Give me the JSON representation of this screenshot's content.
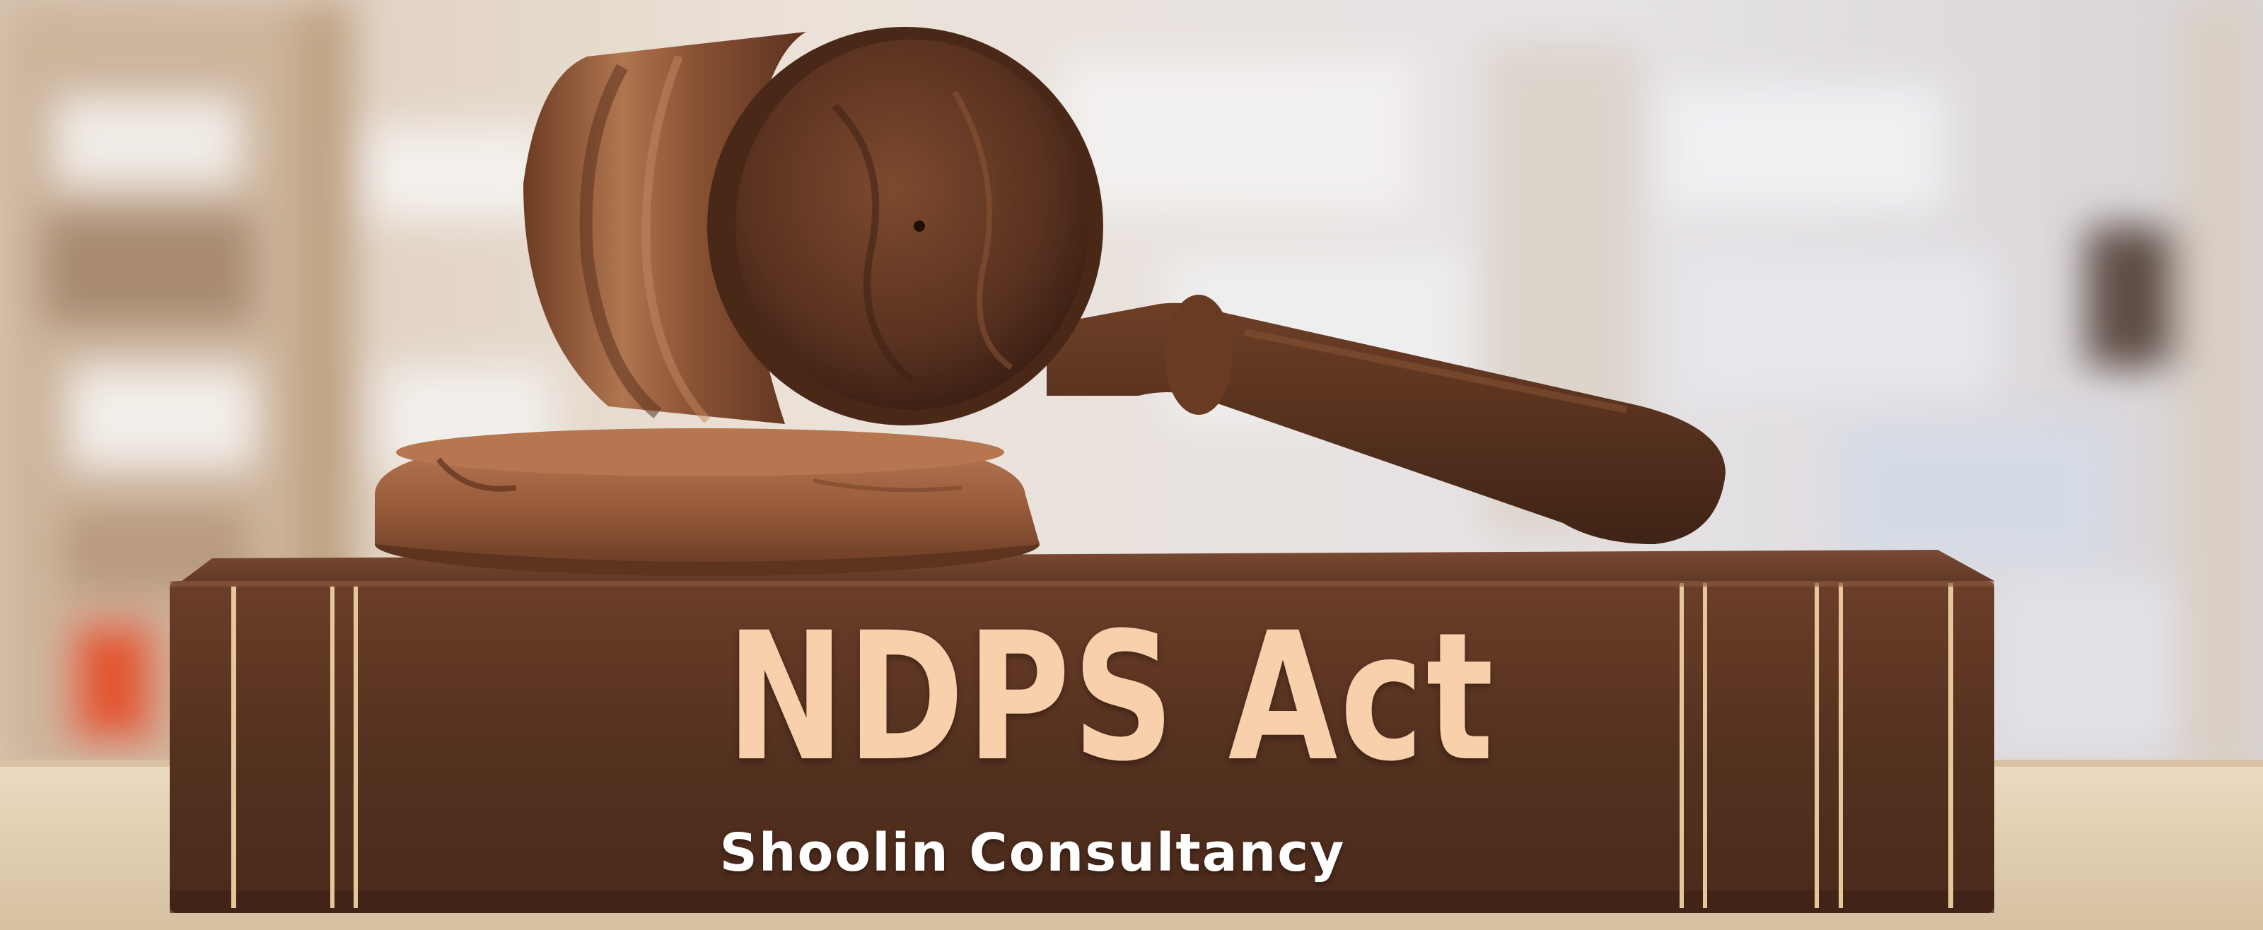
{
  "banner": {
    "title": "NDPS Act",
    "subtitle": "Shoolin Consultancy"
  },
  "scene": {
    "objects": [
      "gavel-icon",
      "sound-block",
      "law-book",
      "bookshelf-background",
      "wooden-table"
    ]
  },
  "colors": {
    "title_text": "#f8d1ac",
    "subtitle_text": "#ffffff",
    "book_cover": "#5a3423",
    "book_stripes": "#e6c79a",
    "wood": "#8a5536"
  }
}
